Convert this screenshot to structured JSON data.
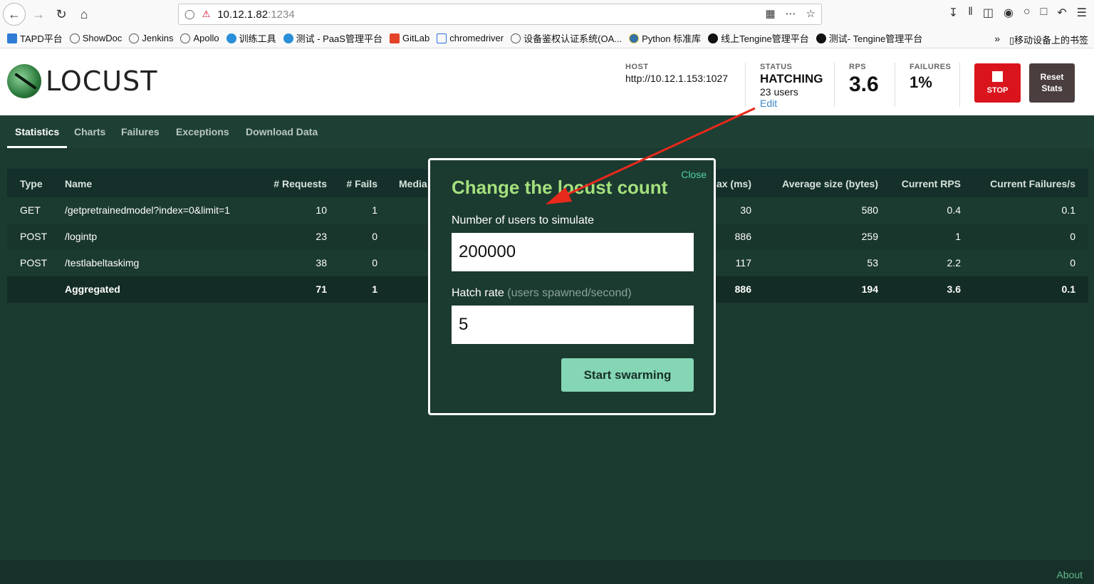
{
  "browser": {
    "url_host": "10.12.1.82",
    "url_port": ":1234",
    "bookmarks": [
      "TAPD平台",
      "ShowDoc",
      "Jenkins",
      "Apollo",
      "训练工具",
      "测试 - PaaS管理平台",
      "GitLab",
      "chromedriver",
      "设备鉴权认证系统(OA...",
      "Python 标准库",
      "线上Tengine管理平台",
      "测试- Tengine管理平台"
    ],
    "mobile_bookmarks": "移动设备上的书签"
  },
  "header": {
    "logo_text": "LOCUST",
    "host_label": "HOST",
    "host_value": "http://10.12.1.153:1027",
    "status_label": "STATUS",
    "status_value": "HATCHING",
    "status_users": "23 users",
    "status_edit": "Edit",
    "rps_label": "RPS",
    "rps_value": "3.6",
    "failures_label": "FAILURES",
    "failures_value": "1%",
    "stop_label": "STOP",
    "reset_label": "Reset Stats"
  },
  "tabs": [
    "Statistics",
    "Charts",
    "Failures",
    "Exceptions",
    "Download Data"
  ],
  "table": {
    "headers": [
      "Type",
      "Name",
      "# Requests",
      "# Fails",
      "Media",
      "ax (ms)",
      "Average size (bytes)",
      "Current RPS",
      "Current Failures/s"
    ],
    "rows": [
      [
        "GET",
        "/getpretrainedmodel?index=0&limit=1",
        "10",
        "1",
        "30",
        "580",
        "0.4",
        "0.1"
      ],
      [
        "POST",
        "/logintp",
        "23",
        "0",
        "886",
        "259",
        "1",
        "0"
      ],
      [
        "POST",
        "/testlabeltaskimg",
        "38",
        "0",
        "117",
        "53",
        "2.2",
        "0"
      ]
    ],
    "aggregated": [
      "",
      "Aggregated",
      "71",
      "1",
      "886",
      "194",
      "3.6",
      "0.1"
    ]
  },
  "modal": {
    "close": "Close",
    "title": "Change the locust count",
    "users_label": "Number of users to simulate",
    "users_value": "200000",
    "hatch_label": "Hatch rate",
    "hatch_sub": "(users spawned/second)",
    "hatch_value": "5",
    "submit": "Start swarming"
  },
  "footer": {
    "about": "About"
  },
  "colors": {
    "accent_green": "#a4e07d",
    "stop_red": "#d9141c",
    "bg_dark": "#1b3a30",
    "annotation_arrow": "#e8291c"
  }
}
